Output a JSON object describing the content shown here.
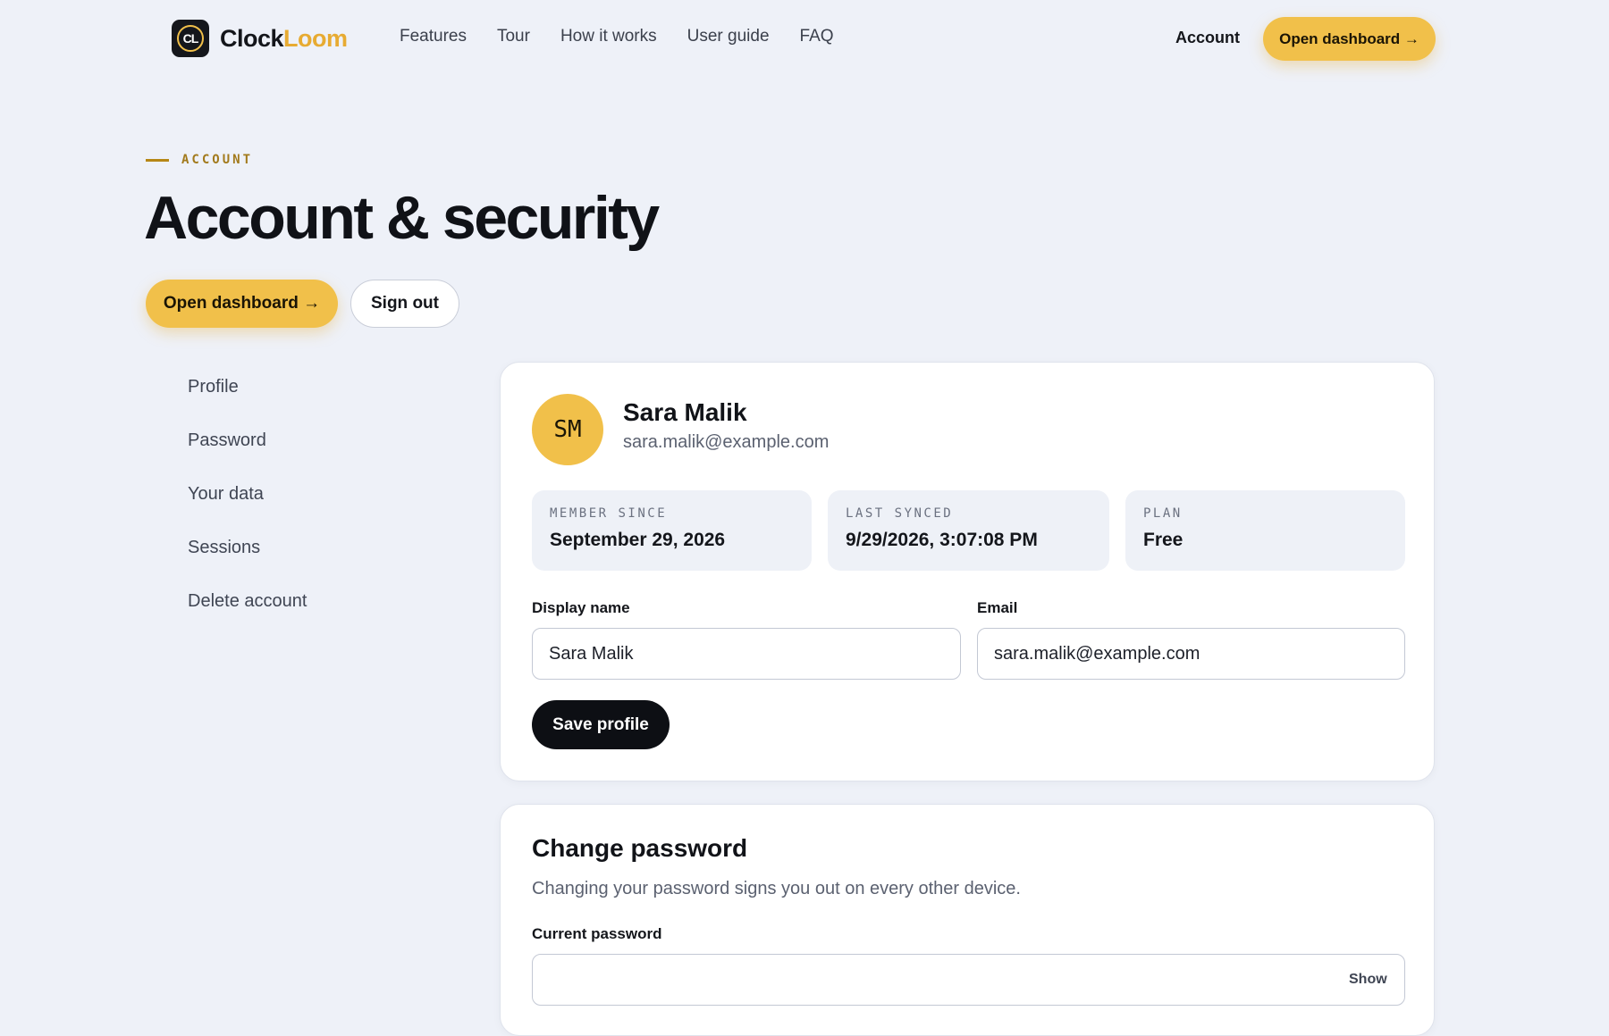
{
  "header": {
    "logo_mark": "CL",
    "logo_part1": "Clock",
    "logo_part2": "Loom",
    "nav": [
      "Features",
      "Tour",
      "How it works",
      "User guide",
      "FAQ"
    ],
    "account_link": "Account",
    "cta": "Open dashboard →"
  },
  "hero": {
    "eyebrow": "ACCOUNT",
    "title": "Account & security",
    "cta": "Open dashboard →",
    "signout": "Sign out"
  },
  "sidebar": {
    "items": [
      "Profile",
      "Password",
      "Your data",
      "Sessions",
      "Delete account"
    ]
  },
  "profile": {
    "initials": "SM",
    "name": "Sara Malik",
    "email": "sara.malik@example.com",
    "stats": [
      {
        "label": "MEMBER SINCE",
        "value": "September 29, 2026"
      },
      {
        "label": "LAST SYNCED",
        "value": "9/29/2026, 3:07:08 PM"
      },
      {
        "label": "PLAN",
        "value": "Free"
      }
    ],
    "display_name_label": "Display name",
    "display_name_value": "Sara Malik",
    "email_label": "Email",
    "email_value": "sara.malik@example.com",
    "save_label": "Save profile"
  },
  "password": {
    "title": "Change password",
    "subtitle": "Changing your password signs you out on every other device.",
    "current_label": "Current password",
    "current_value": "",
    "show_label": "Show"
  },
  "colors": {
    "accent": "#f1c04a",
    "background": "#eef1f8",
    "dark": "#0d0f14"
  }
}
